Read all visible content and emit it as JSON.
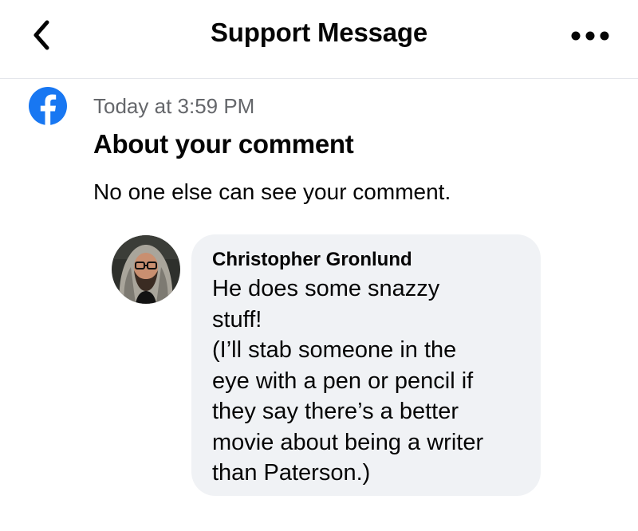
{
  "header": {
    "title": "Support Message",
    "back_icon": "chevron-left-icon",
    "more_icon": "more-horizontal-icon"
  },
  "message": {
    "sender_icon": "facebook-logo-icon",
    "brand_color": "#1877f2",
    "timestamp": "Today at 3:59 PM",
    "title": "About your comment",
    "body": "No one else can see your comment."
  },
  "comment": {
    "author": "Christopher Gronlund",
    "text": "He does some snazzy\nstuff!\n(I’ll stab someone in the\neye with a pen or pencil if\nthey say there’s a better\nmovie about being a writer\nthan Paterson.)",
    "bubble_color": "#f0f2f5"
  }
}
